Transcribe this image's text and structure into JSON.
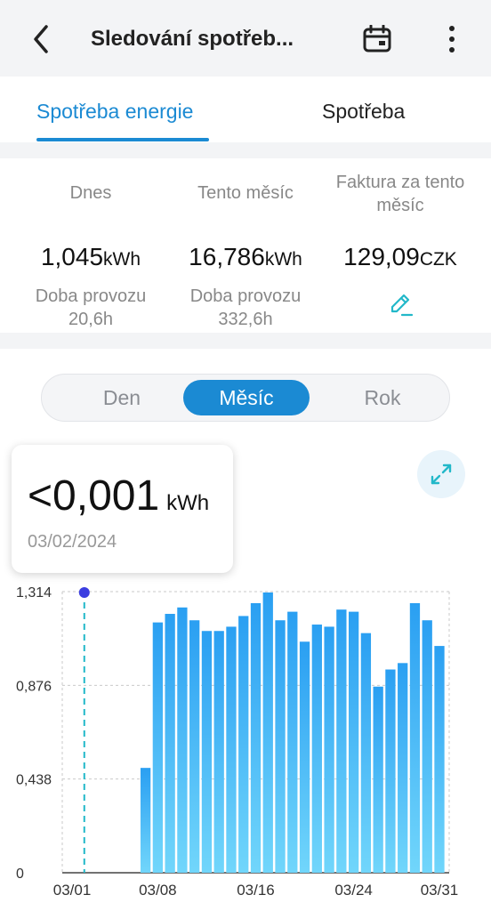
{
  "header": {
    "title": "Sledování spotřeb...",
    "back_icon": "chevron-left-icon",
    "calendar_icon": "calendar-icon",
    "more_icon": "more-vertical-icon"
  },
  "tabs": [
    {
      "label": "Spotřeba energie",
      "active": true
    },
    {
      "label": "Spotřeba",
      "active": false
    }
  ],
  "stats": {
    "today": {
      "label": "Dnes",
      "value": "1,045",
      "unit": "kWh",
      "sub_label": "Doba provozu",
      "sub_value": "20,6h"
    },
    "month": {
      "label": "Tento měsíc",
      "value": "16,786",
      "unit": "kWh",
      "sub_label": "Doba provozu",
      "sub_value": "332,6h"
    },
    "invoice": {
      "label": "Faktura za tento měsíc",
      "value": "129,09",
      "unit": "CZK",
      "edit_icon": "pencil-edit-icon"
    }
  },
  "period_selector": {
    "options": [
      "Den",
      "Měsíc",
      "Rok"
    ],
    "selected": "Měsíc"
  },
  "tooltip": {
    "value": "<0,001",
    "unit": "kWh",
    "date": "03/02/2024"
  },
  "expand_icon": "expand-arrows-icon",
  "colors": {
    "accent": "#1b8ad3",
    "bar_top": "#2a9ff2",
    "bar_bottom": "#71d6fb",
    "cursor": "#3b3ee0"
  },
  "chart_data": {
    "type": "bar",
    "x": [
      1,
      2,
      3,
      4,
      5,
      6,
      7,
      8,
      9,
      10,
      11,
      12,
      13,
      14,
      15,
      16,
      17,
      18,
      19,
      20,
      21,
      22,
      23,
      24,
      25,
      26,
      27,
      28,
      29,
      30,
      31
    ],
    "values": [
      0,
      0,
      0,
      0,
      0,
      0,
      0.49,
      1.17,
      1.21,
      1.24,
      1.18,
      1.13,
      1.13,
      1.15,
      1.2,
      1.26,
      1.31,
      1.18,
      1.22,
      1.08,
      1.16,
      1.15,
      1.23,
      1.22,
      1.12,
      0.87,
      0.95,
      0.98,
      1.26,
      1.18,
      1.06
    ],
    "x_tick_labels": [
      "03/01",
      "03/08",
      "03/16",
      "03/24",
      "03/31"
    ],
    "x_tick_days": [
      1,
      8,
      16,
      24,
      31
    ],
    "y_ticks": [
      "1,314",
      "0,876",
      "0,438",
      "0"
    ],
    "ylim": [
      0,
      1.314
    ],
    "selected_day": 2,
    "grid": true
  }
}
